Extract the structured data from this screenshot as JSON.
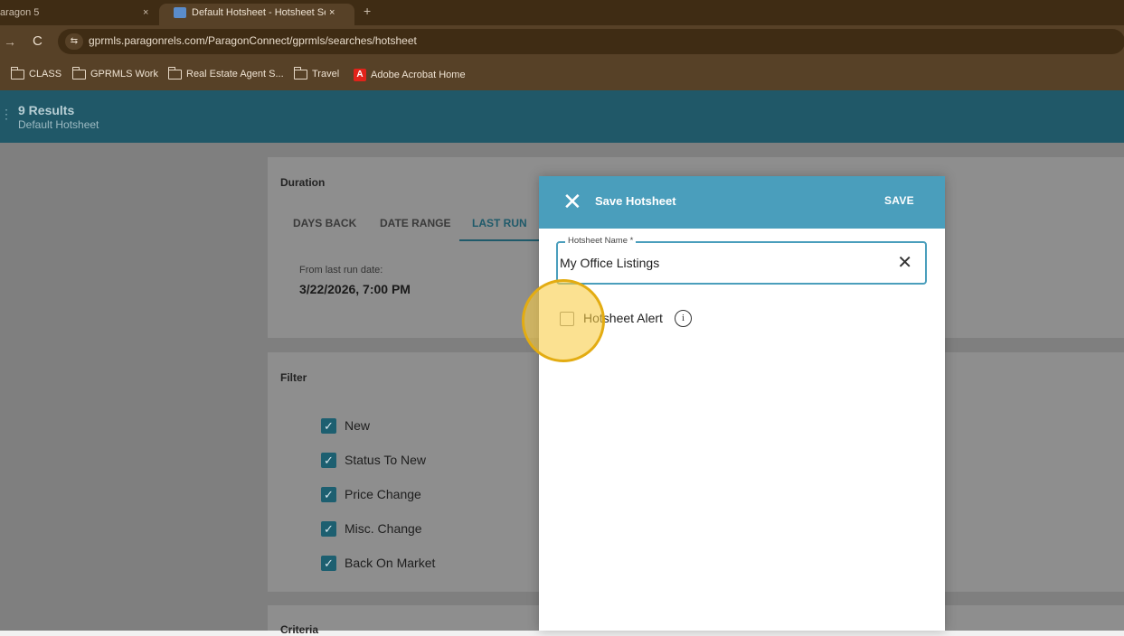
{
  "browser": {
    "tabs": [
      {
        "title": "aragon 5",
        "close": "×"
      },
      {
        "title": "Default Hotsheet - Hotsheet Se",
        "close": "×"
      }
    ],
    "new_tab": "+",
    "back": "→",
    "reload": "C",
    "site_icon": "⇆",
    "url": "gprmls.paragonrels.com/ParagonConnect/gprmls/searches/hotsheet",
    "bookmarks": [
      {
        "label": "CLASS",
        "icon": "folder-icon"
      },
      {
        "label": "GPRMLS Work",
        "icon": "folder-icon"
      },
      {
        "label": "Real Estate Agent S...",
        "icon": "folder-icon"
      },
      {
        "label": "Travel",
        "icon": "folder-icon"
      },
      {
        "label": "Adobe Acrobat Home",
        "icon": "acrobat-icon"
      }
    ]
  },
  "header": {
    "results": "9 Results",
    "subtitle": "Default Hotsheet"
  },
  "duration": {
    "label": "Duration",
    "tabs": [
      "DAYS BACK",
      "DATE RANGE",
      "LAST RUN"
    ],
    "active_tab": "LAST RUN",
    "from_label": "From last run date:",
    "from_value": "3/22/2026, 7:00 PM"
  },
  "filter": {
    "label": "Filter",
    "items": [
      {
        "label": "New",
        "checked": true
      },
      {
        "label": "Status To New",
        "checked": true
      },
      {
        "label": "Price Change",
        "checked": true
      },
      {
        "label": "Misc. Change",
        "checked": true
      },
      {
        "label": "Back On Market",
        "checked": true
      }
    ]
  },
  "criteria": {
    "label": "Criteria"
  },
  "dialog": {
    "close_icon": "✕",
    "title": "Save Hotsheet",
    "save_label": "SAVE",
    "name_label": "Hotsheet Name *",
    "name_value": "My Office Listings",
    "clear_icon": "✕",
    "alert_label": "Hotsheet Alert",
    "alert_checked": false,
    "info_icon": "i"
  },
  "colors": {
    "header": "#205868",
    "dialog_header": "#4a9ebc",
    "checkbox": "#1d5f70",
    "highlight": "#f9cd48"
  }
}
